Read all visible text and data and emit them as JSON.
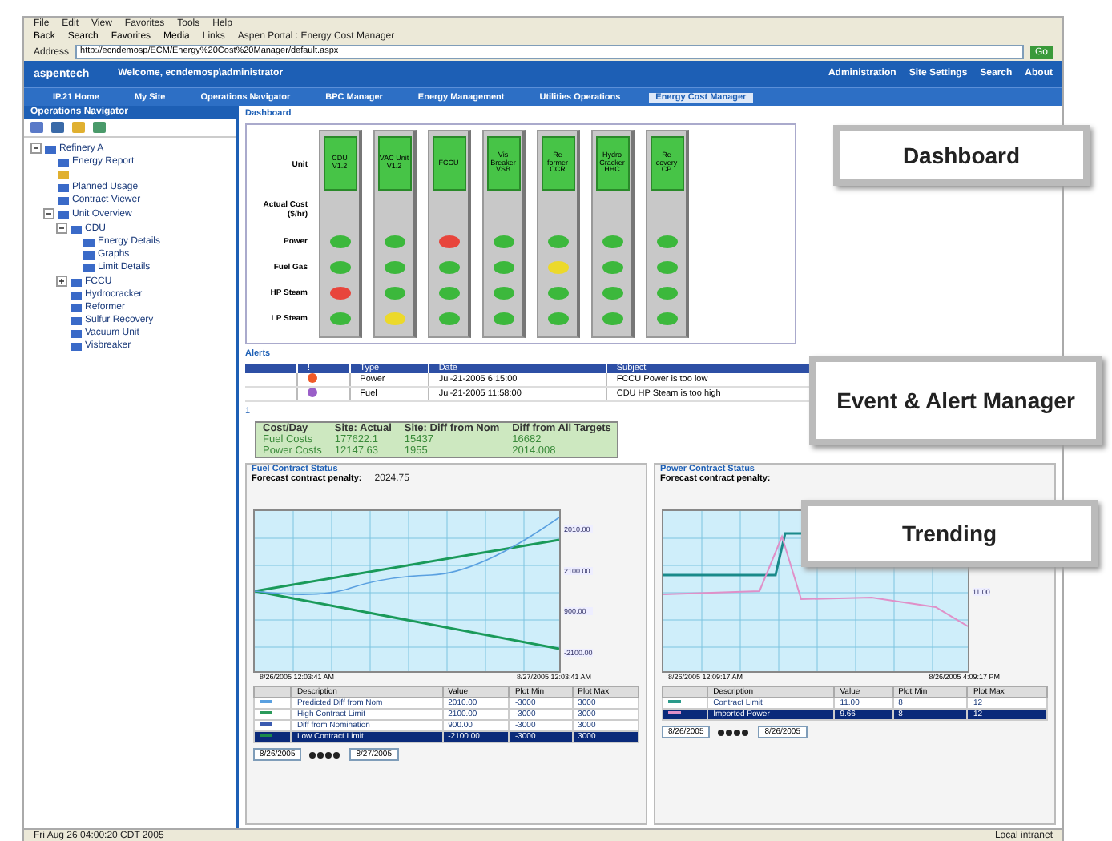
{
  "browser": {
    "menu": [
      "File",
      "Edit",
      "View",
      "Favorites",
      "Tools",
      "Help"
    ],
    "toolbar": [
      "Back",
      "Search",
      "Favorites",
      "Media"
    ],
    "links_label": "Links",
    "link": "Aspen Portal : Energy Cost Manager",
    "address_label": "Address",
    "address": "http://ecndemosp/ECM/Energy%20Cost%20Manager/default.aspx",
    "go": "Go"
  },
  "header": {
    "logo": "aspentech",
    "welcome": "Welcome, ecndemosp\\administrator",
    "links": [
      "Administration",
      "Site Settings",
      "Search",
      "About"
    ]
  },
  "nav_tabs": [
    {
      "label": "IP.21 Home",
      "selected": false
    },
    {
      "label": "My Site",
      "selected": false
    },
    {
      "label": "Operations Navigator",
      "selected": false
    },
    {
      "label": "BPC Manager",
      "selected": false
    },
    {
      "label": "Energy Management",
      "selected": false
    },
    {
      "label": "Utilities Operations",
      "selected": false
    },
    {
      "label": "Energy Cost Manager",
      "selected": true
    }
  ],
  "sidebar": {
    "title": "Operations Navigator",
    "tree": [
      {
        "label": "Refinery A",
        "expanded": true,
        "children": [
          {
            "kind": "item",
            "label": "Energy Report"
          },
          {
            "kind": "icon"
          },
          {
            "kind": "item",
            "label": "Planned Usage"
          },
          {
            "kind": "item",
            "label": "Contract Viewer"
          },
          {
            "kind": "item",
            "label": "Unit Overview",
            "expanded": true,
            "children": [
              {
                "label": "CDU",
                "expanded": true,
                "children": [
                  {
                    "label": "Energy Details"
                  },
                  {
                    "label": "Graphs"
                  },
                  {
                    "label": "Limit Details"
                  }
                ]
              },
              {
                "label": "FCCU",
                "expanded": false
              },
              {
                "label": "Hydrocracker"
              },
              {
                "label": "Reformer"
              },
              {
                "label": "Sulfur Recovery"
              },
              {
                "label": "Vacuum Unit"
              },
              {
                "label": "Visbreaker"
              }
            ]
          }
        ]
      }
    ]
  },
  "dashboard": {
    "title": "Dashboard",
    "row_labels": [
      "Unit",
      "Actual Cost ($/hr)",
      "Power",
      "Fuel Gas",
      "HP Steam",
      "LP Steam"
    ],
    "units": [
      {
        "name": "CDU V1.2",
        "lamps": [
          {
            "color": "#3cb83c"
          },
          {
            "color": "#3cb83c"
          },
          {
            "color": "#e8453c"
          },
          {
            "color": "#3cb83c"
          }
        ]
      },
      {
        "name": "VAC Unit V1.2",
        "lamps": [
          {
            "color": "#3cb83c"
          },
          {
            "color": "#3cb83c"
          },
          {
            "color": "#3cb83c"
          },
          {
            "color": "#ecd92a"
          }
        ]
      },
      {
        "name": "FCCU",
        "lamps": [
          {
            "color": "#e8453c"
          },
          {
            "color": "#3cb83c"
          },
          {
            "color": "#3cb83c"
          },
          {
            "color": "#3cb83c"
          }
        ]
      },
      {
        "name": "Vis Breaker VSB",
        "lamps": [
          {
            "color": "#3cb83c"
          },
          {
            "color": "#3cb83c"
          },
          {
            "color": "#3cb83c"
          },
          {
            "color": "#3cb83c"
          }
        ]
      },
      {
        "name": "Re former CCR",
        "lamps": [
          {
            "color": "#3cb83c"
          },
          {
            "color": "#ecd92a"
          },
          {
            "color": "#3cb83c"
          },
          {
            "color": "#3cb83c"
          }
        ]
      },
      {
        "name": "Hydro Cracker HHC",
        "lamps": [
          {
            "color": "#3cb83c"
          },
          {
            "color": "#3cb83c"
          },
          {
            "color": "#3cb83c"
          },
          {
            "color": "#3cb83c"
          }
        ]
      },
      {
        "name": "Re covery CP",
        "lamps": [
          {
            "color": "#3cb83c"
          },
          {
            "color": "#3cb83c"
          },
          {
            "color": "#3cb83c"
          },
          {
            "color": "#3cb83c"
          }
        ]
      }
    ]
  },
  "alerts": {
    "title": "Alerts",
    "columns": [
      "!",
      "Type",
      "Date",
      "Subject"
    ],
    "rows": [
      {
        "color": "#f05a28",
        "type": "Power",
        "date": "Jul-21-2005 6:15:00",
        "subject": "FCCU Power is too low"
      },
      {
        "color": "#9a5fc8",
        "type": "Fuel",
        "date": "Jul-21-2005 11:58:00",
        "subject": "CDU HP Steam is too high"
      }
    ],
    "pager": "1"
  },
  "costs": {
    "columns": [
      "Cost/Day",
      "Site: Actual",
      "Site: Diff from Nom",
      "Diff from All Targets"
    ],
    "rows": [
      [
        "Fuel Costs",
        "177622.1",
        "15437",
        "16682"
      ],
      [
        "Power Costs",
        "12147.63",
        "1955",
        "2014.008"
      ]
    ]
  },
  "trends": [
    {
      "kind": "fuel",
      "title": "Fuel Contract Status",
      "penalty_label": "Forecast contract penalty:",
      "penalty": "2024.75",
      "x_start": "8/26/2005 12:03:41 AM",
      "x_end": "8/27/2005 12:03:41 AM",
      "end_labels": [
        "2010.00",
        "2100.00",
        "900.00",
        "-2100.00"
      ],
      "legend_columns": [
        "Description",
        "Value",
        "Plot Min",
        "Plot Max"
      ],
      "legend": [
        {
          "name": "Predicted Diff from Nom",
          "value": "2010.00",
          "min": "-3000",
          "max": "3000",
          "color": "#5aa0e0",
          "selected": false
        },
        {
          "name": "High Contract Limit",
          "value": "2100.00",
          "min": "-3000",
          "max": "3000",
          "color": "#2a9a5a",
          "selected": false
        },
        {
          "name": "Diff from Nomination",
          "value": "900.00",
          "min": "-3000",
          "max": "3000",
          "color": "#3a5ab0",
          "selected": false
        },
        {
          "name": "Low Contract Limit",
          "value": "-2100.00",
          "min": "-3000",
          "max": "3000",
          "color": "#1a8a4a",
          "selected": true
        }
      ],
      "from": "8/26/2005",
      "to": "8/27/2005"
    },
    {
      "kind": "power",
      "title": "Power Contract Status",
      "penalty_label": "Forecast contract penalty:",
      "x_start": "8/26/2005 12:09:17 AM",
      "x_end": "8/26/2005 4:09:17 PM",
      "end_labels": [
        "11.00"
      ],
      "legend_columns": [
        "Description",
        "Value",
        "Plot Min",
        "Plot Max"
      ],
      "legend": [
        {
          "name": "Contract Limit",
          "value": "11.00",
          "min": "8",
          "max": "12",
          "color": "#2a9a8a",
          "selected": false
        },
        {
          "name": "Imported Power",
          "value": "9.66",
          "min": "8",
          "max": "12",
          "color": "#e090c8",
          "selected": true
        }
      ],
      "from": "8/26/2005",
      "to": "8/26/2005"
    }
  ],
  "status_bar": {
    "left": "Fri Aug 26 04:00:20 CDT 2005",
    "right": "Local intranet"
  },
  "callouts": [
    "Dashboard",
    "Event & Alert Manager",
    "Trending"
  ]
}
